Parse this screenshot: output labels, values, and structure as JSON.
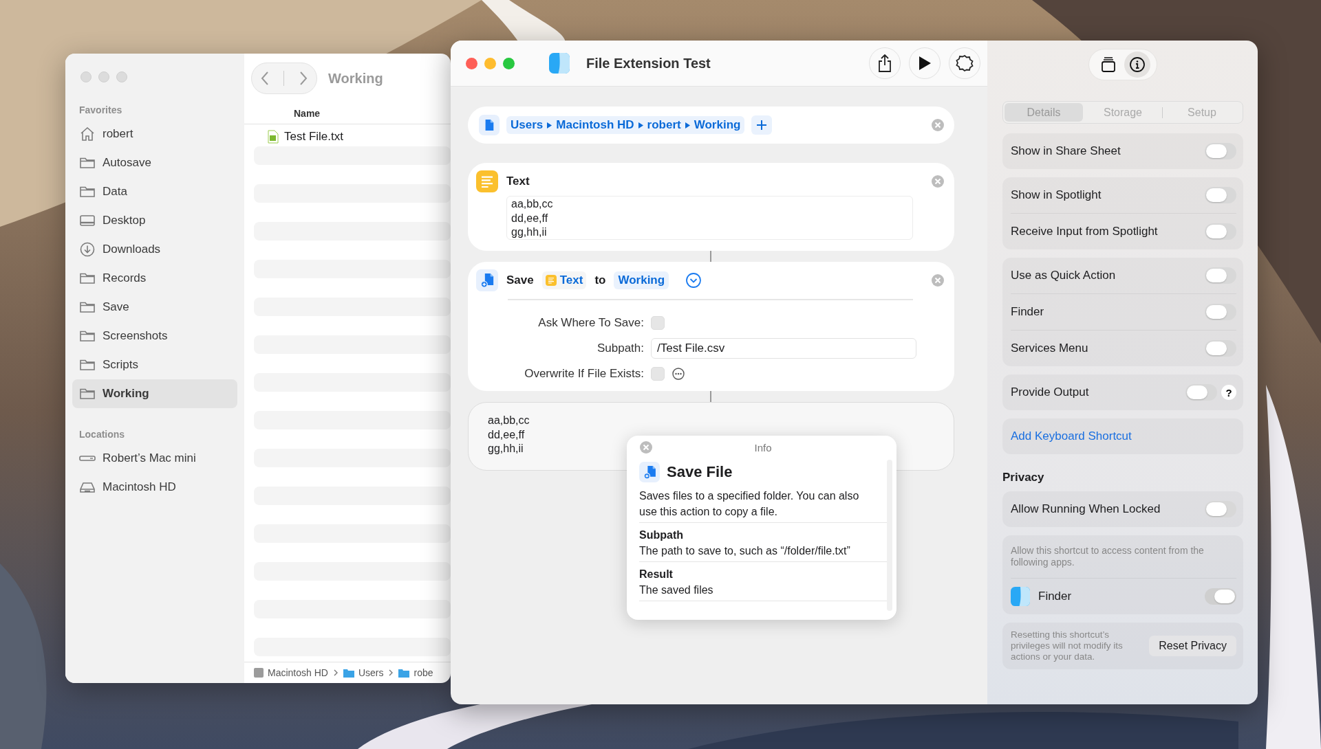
{
  "finder": {
    "sidebar": [
      {
        "title": "Favorites",
        "items": [
          {
            "label": "robert",
            "kind": "home",
            "selected": false
          },
          {
            "label": "Autosave",
            "kind": "folder",
            "selected": false
          },
          {
            "label": "Data",
            "kind": "folder",
            "selected": false
          },
          {
            "label": "Desktop",
            "kind": "desktop",
            "selected": false
          },
          {
            "label": "Downloads",
            "kind": "download",
            "selected": false
          },
          {
            "label": "Records",
            "kind": "folder",
            "selected": false
          },
          {
            "label": "Save",
            "kind": "folder",
            "selected": false
          },
          {
            "label": "Screenshots",
            "kind": "folder",
            "selected": false
          },
          {
            "label": "Scripts",
            "kind": "folder",
            "selected": false
          },
          {
            "label": "Working",
            "kind": "folder",
            "selected": true
          }
        ]
      },
      {
        "title": "Locations",
        "items": [
          {
            "label": "Robert’s Mac mini",
            "kind": "computer",
            "selected": false
          },
          {
            "label": "Macintosh HD",
            "kind": "drive",
            "selected": false
          }
        ]
      }
    ],
    "title": "Working",
    "column": "Name",
    "files": [
      "Test File.txt"
    ],
    "path_bar": [
      {
        "label": "Macintosh HD",
        "kind": "drive"
      },
      {
        "label": "Users",
        "kind": "folder"
      },
      {
        "label": "robe",
        "kind": "folder"
      }
    ]
  },
  "shortcut": {
    "title": "File Extension Test",
    "actions": [
      {
        "kind": "path",
        "segments": [
          "Users",
          "Macintosh HD",
          "robert",
          "Working"
        ]
      },
      {
        "kind": "text",
        "title": "Text",
        "lines": [
          "aa,bb,cc",
          "dd,ee,ff",
          "gg,hh,ii"
        ]
      },
      {
        "kind": "save",
        "verb": "Save",
        "input": "Text",
        "connector": "to",
        "destination": "Working",
        "params": [
          {
            "label": "Ask Where To Save:",
            "kind": "checkbox",
            "checked": false
          },
          {
            "label": "Subpath:",
            "kind": "field",
            "value": "/Test File.csv"
          },
          {
            "label": "Overwrite If File Exists:",
            "kind": "checkbox",
            "checked": false,
            "more": true
          }
        ]
      }
    ],
    "output": [
      "aa,bb,cc",
      "dd,ee,ff",
      "gg,hh,ii"
    ],
    "info": {
      "header": "Info",
      "title": "Save File",
      "description": "Saves files to a specified folder. You can also use this action to copy a file.",
      "sections": [
        {
          "heading": "Subpath",
          "text": "The path to save to, such as “/folder/file.txt”"
        },
        {
          "heading": "Result",
          "text": "The saved files"
        }
      ]
    }
  },
  "inspector": {
    "panel_buttons": [
      {
        "kind": "stack",
        "selected": false
      },
      {
        "kind": "info",
        "selected": true
      }
    ],
    "tabs": [
      {
        "label": "Details",
        "selected": true
      },
      {
        "label": "Storage",
        "selected": false
      },
      {
        "label": "Setup",
        "selected": false
      }
    ],
    "groups": [
      [
        {
          "label": "Show in Share Sheet",
          "on": false
        }
      ],
      [
        {
          "label": "Show in Spotlight",
          "on": false
        },
        {
          "label": "Receive Input from Spotlight",
          "on": false
        }
      ],
      [
        {
          "label": "Use as Quick Action",
          "on": false
        },
        {
          "label": "Finder",
          "on": false
        },
        {
          "label": "Services Menu",
          "on": false
        }
      ],
      [
        {
          "label": "Provide Output",
          "on": false,
          "help": "?"
        }
      ]
    ],
    "add_shortcut": "Add Keyboard Shortcut",
    "privacy": {
      "title": "Privacy",
      "locked": {
        "label": "Allow Running When Locked",
        "on": false
      },
      "note": "Allow this shortcut to access content from the following apps.",
      "apps": [
        {
          "name": "Finder",
          "on": true
        }
      ],
      "reset_note": "Resetting this shortcut’s privileges will not modify its actions or your data.",
      "reset_button": "Reset Privacy"
    }
  }
}
